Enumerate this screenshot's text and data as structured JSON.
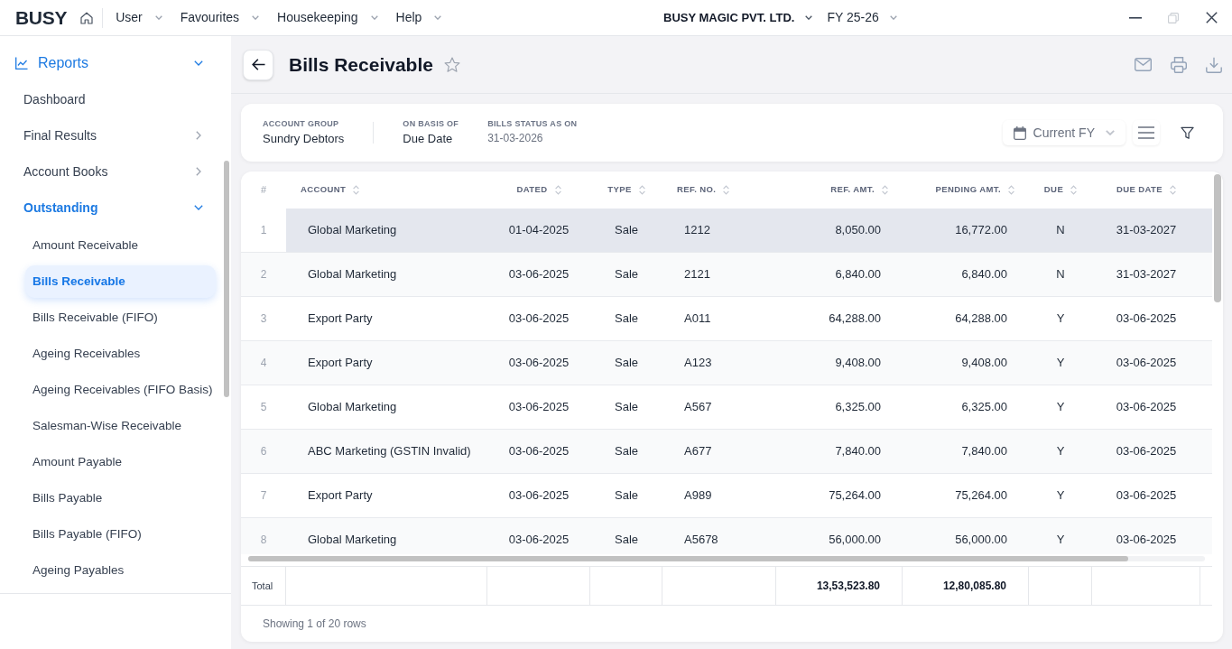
{
  "top_bar": {
    "logo": "BUSY",
    "menus": [
      {
        "label": "User"
      },
      {
        "label": "Favourites"
      },
      {
        "label": "Housekeeping"
      },
      {
        "label": "Help"
      }
    ],
    "company": "BUSY MAGIC PVT. LTD.",
    "financial_year": "FY 25-26",
    "window_controls": [
      {
        "kind": "minimize",
        "disabled": false
      },
      {
        "kind": "restore",
        "disabled": true
      },
      {
        "kind": "close",
        "disabled": false
      }
    ]
  },
  "sidebar": {
    "section": {
      "label": "Reports",
      "expanded": true
    },
    "items": [
      {
        "kind": "page",
        "label": "Dashboard"
      },
      {
        "kind": "group",
        "label": "Final Results",
        "expanded": false
      },
      {
        "kind": "group",
        "label": "Account Books",
        "expanded": false
      },
      {
        "kind": "group",
        "label": "Outstanding",
        "expanded": true,
        "children": [
          {
            "label": "Amount Receivable",
            "selected": false
          },
          {
            "label": "Bills Receivable",
            "selected": true
          },
          {
            "label": "Bills Receivable (FIFO)",
            "selected": false
          },
          {
            "label": "Ageing Receivables",
            "selected": false
          },
          {
            "label": "Ageing Receivables (FIFO Basis)",
            "selected": false
          },
          {
            "label": "Salesman-Wise Receivable",
            "selected": false
          },
          {
            "label": "Amount Payable",
            "selected": false
          },
          {
            "label": "Bills Payable",
            "selected": false
          },
          {
            "label": "Bills Payable (FIFO)",
            "selected": false
          },
          {
            "label": "Ageing Payables",
            "selected": false
          }
        ]
      }
    ]
  },
  "page_header": {
    "title": "Bills Receivable",
    "favourite": false
  },
  "filters": {
    "fields": [
      {
        "kind": "text",
        "label": "ACCOUNT GROUP",
        "value": "Sundry Debtors"
      },
      {
        "kind": "text",
        "label": "ON BASIS OF",
        "value": "Due Date"
      },
      {
        "kind": "date",
        "label": "BILLS STATUS AS ON",
        "value": "31-03-2026"
      }
    ],
    "period": "Current FY"
  },
  "table": {
    "columns": [
      {
        "label": "#",
        "sortable": false
      },
      {
        "label": "ACCOUNT",
        "sortable": true
      },
      {
        "label": "DATED",
        "sortable": true
      },
      {
        "label": "TYPE",
        "sortable": true
      },
      {
        "label": "REF. NO.",
        "sortable": true
      },
      {
        "label": "REF. AMT.",
        "sortable": true
      },
      {
        "label": "PENDING AMT.",
        "sortable": true
      },
      {
        "label": "DUE",
        "sortable": true
      },
      {
        "label": "DUE DATE",
        "sortable": true
      }
    ],
    "rows": [
      {
        "selected": true,
        "cells": [
          "1",
          "Global Marketing",
          "01-04-2025",
          "Sale",
          "1212",
          "8,050.00",
          "16,772.00",
          "N",
          "31-03-2027"
        ]
      },
      {
        "selected": false,
        "cells": [
          "2",
          "Global Marketing",
          "03-06-2025",
          "Sale",
          "2121",
          "6,840.00",
          "6,840.00",
          "N",
          "31-03-2027"
        ]
      },
      {
        "selected": false,
        "cells": [
          "3",
          "Export Party",
          "03-06-2025",
          "Sale",
          "A011",
          "64,288.00",
          "64,288.00",
          "Y",
          "03-06-2025"
        ]
      },
      {
        "selected": false,
        "cells": [
          "4",
          "Export Party",
          "03-06-2025",
          "Sale",
          "A123",
          "9,408.00",
          "9,408.00",
          "Y",
          "03-06-2025"
        ]
      },
      {
        "selected": false,
        "cells": [
          "5",
          "Global Marketing",
          "03-06-2025",
          "Sale",
          "A567",
          "6,325.00",
          "6,325.00",
          "Y",
          "03-06-2025"
        ]
      },
      {
        "selected": false,
        "cells": [
          "6",
          "ABC Marketing (GSTIN Invalid)",
          "03-06-2025",
          "Sale",
          "A677",
          "7,840.00",
          "7,840.00",
          "Y",
          "03-06-2025"
        ]
      },
      {
        "selected": false,
        "cells": [
          "7",
          "Export Party",
          "03-06-2025",
          "Sale",
          "A989",
          "75,264.00",
          "75,264.00",
          "Y",
          "03-06-2025"
        ]
      },
      {
        "selected": false,
        "cells": [
          "8",
          "Global Marketing",
          "03-06-2025",
          "Sale",
          "A5678",
          "56,000.00",
          "56,000.00",
          "Y",
          "03-06-2025"
        ]
      }
    ],
    "totals": {
      "label": "Total",
      "ref_amt": "13,53,523.80",
      "pending_amt": "12,80,085.80"
    },
    "footer": "Showing 1 of 20 rows"
  }
}
